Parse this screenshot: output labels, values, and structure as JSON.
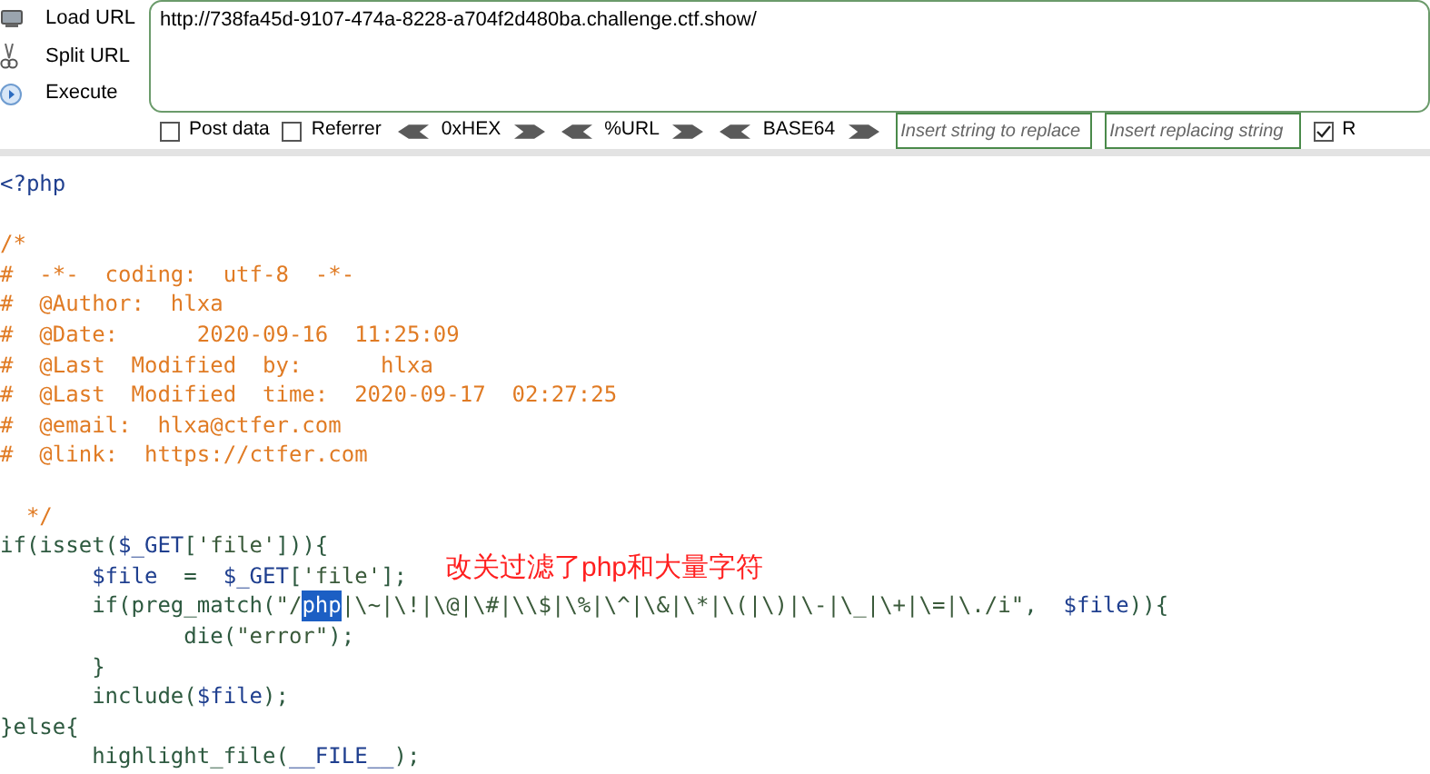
{
  "toolbar": {
    "actions": [
      {
        "label": "Load URL",
        "kind": "load"
      },
      {
        "label": "Split URL",
        "kind": "split"
      },
      {
        "label": "Execute",
        "kind": "execute"
      }
    ],
    "url": "http://738fa45d-9107-474a-8228-a704f2d480ba.challenge.ctf.show/",
    "options": [
      {
        "label": "Post data",
        "checked": false
      },
      {
        "label": "Referrer",
        "checked": false
      }
    ],
    "encoders": [
      "0xHEX",
      "%URL",
      "BASE64"
    ],
    "replace": {
      "find_placeholder": "Insert string to replace",
      "replace_placeholder": "Insert replacing string"
    },
    "replace_option": {
      "label": "R",
      "checked": true
    }
  },
  "code_blocks": [
    [
      [
        {
          "text": "<?php",
          "kind": "default"
        }
      ]
    ],
    [
      [
        {
          "text": "/*",
          "kind": "comment"
        }
      ],
      [
        {
          "text": "#  -*-  coding:  utf-8  -*-",
          "kind": "comment"
        }
      ],
      [
        {
          "text": "#  @Author:  hlxa",
          "kind": "comment"
        }
      ],
      [
        {
          "text": "#  @Date:      2020-09-16  11:25:09",
          "kind": "comment"
        }
      ],
      [
        {
          "text": "#  @Last  Modified  by:      hlxa",
          "kind": "comment"
        }
      ],
      [
        {
          "text": "#  @Last  Modified  time:  2020-09-17  02:27:25",
          "kind": "comment"
        }
      ],
      [
        {
          "text": "#  @email:  hlxa@ctfer.com",
          "kind": "comment"
        }
      ],
      [
        {
          "text": "#  @link:  https://ctfer.com",
          "kind": "comment"
        }
      ]
    ],
    [
      [
        {
          "text": "  */",
          "kind": "comment"
        }
      ],
      [
        {
          "text": "if(isset(",
          "kind": "keyword"
        },
        {
          "text": "$_GET",
          "kind": "default"
        },
        {
          "text": "[",
          "kind": "keyword"
        },
        {
          "text": "'file'",
          "kind": "string"
        },
        {
          "text": "])){",
          "kind": "keyword"
        }
      ],
      [
        {
          "text": "       $file  ",
          "kind": "default"
        },
        {
          "text": "=  ",
          "kind": "keyword"
        },
        {
          "text": "$_GET",
          "kind": "default"
        },
        {
          "text": "[",
          "kind": "keyword"
        },
        {
          "text": "'file'",
          "kind": "string"
        },
        {
          "text": "];",
          "kind": "keyword"
        }
      ],
      [
        {
          "text": "       if(preg_match(",
          "kind": "keyword"
        },
        {
          "text": "\"/",
          "kind": "string"
        },
        {
          "text": "php",
          "kind": "selected"
        },
        {
          "text": "|\\~|\\!|\\@|\\#|\\\\$|\\%|\\^|\\&|\\*|\\(|\\)|\\-|\\_|\\+|\\=|\\./i\"",
          "kind": "string"
        },
        {
          "text": ",  ",
          "kind": "keyword"
        },
        {
          "text": "$file",
          "kind": "default"
        },
        {
          "text": ")){",
          "kind": "keyword"
        }
      ],
      [
        {
          "text": "              die(",
          "kind": "keyword"
        },
        {
          "text": "\"error\"",
          "kind": "string"
        },
        {
          "text": ");",
          "kind": "keyword"
        }
      ],
      [
        {
          "text": "       }",
          "kind": "keyword"
        }
      ],
      [
        {
          "text": "       include(",
          "kind": "keyword"
        },
        {
          "text": "$file",
          "kind": "default"
        },
        {
          "text": ");",
          "kind": "keyword"
        }
      ],
      [
        {
          "text": "}else{",
          "kind": "keyword"
        }
      ],
      [
        {
          "text": "       highlight_file(",
          "kind": "keyword"
        },
        {
          "text": "__FILE__",
          "kind": "default"
        },
        {
          "text": ");",
          "kind": "keyword"
        }
      ]
    ]
  ],
  "annotation": "改关过滤了php和大量字符"
}
